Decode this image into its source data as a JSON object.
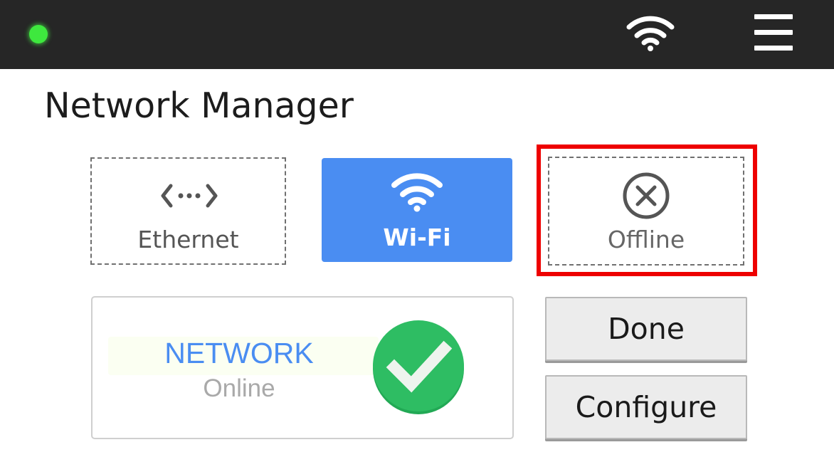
{
  "topbar": {
    "status_indicator": "online-dot",
    "status_color": "#3ee83e",
    "wifi_icon": "wifi-icon",
    "menu_icon": "hamburger-menu-icon"
  },
  "title": "Network Manager",
  "modes": {
    "ethernet": {
      "label": "Ethernet",
      "icon": "ethernet-icon"
    },
    "wifi": {
      "label": "Wi-Fi",
      "icon": "wifi-icon",
      "selected": true,
      "color": "#4a8df2"
    },
    "offline": {
      "label": "Offline",
      "icon": "circle-x-icon",
      "highlighted": true,
      "highlight_color": "#ee0000"
    }
  },
  "status": {
    "title": "NETWORK",
    "state": "Online",
    "icon": "check-circle-icon",
    "icon_color": "#2ebd63"
  },
  "buttons": {
    "done": "Done",
    "configure": "Configure"
  }
}
